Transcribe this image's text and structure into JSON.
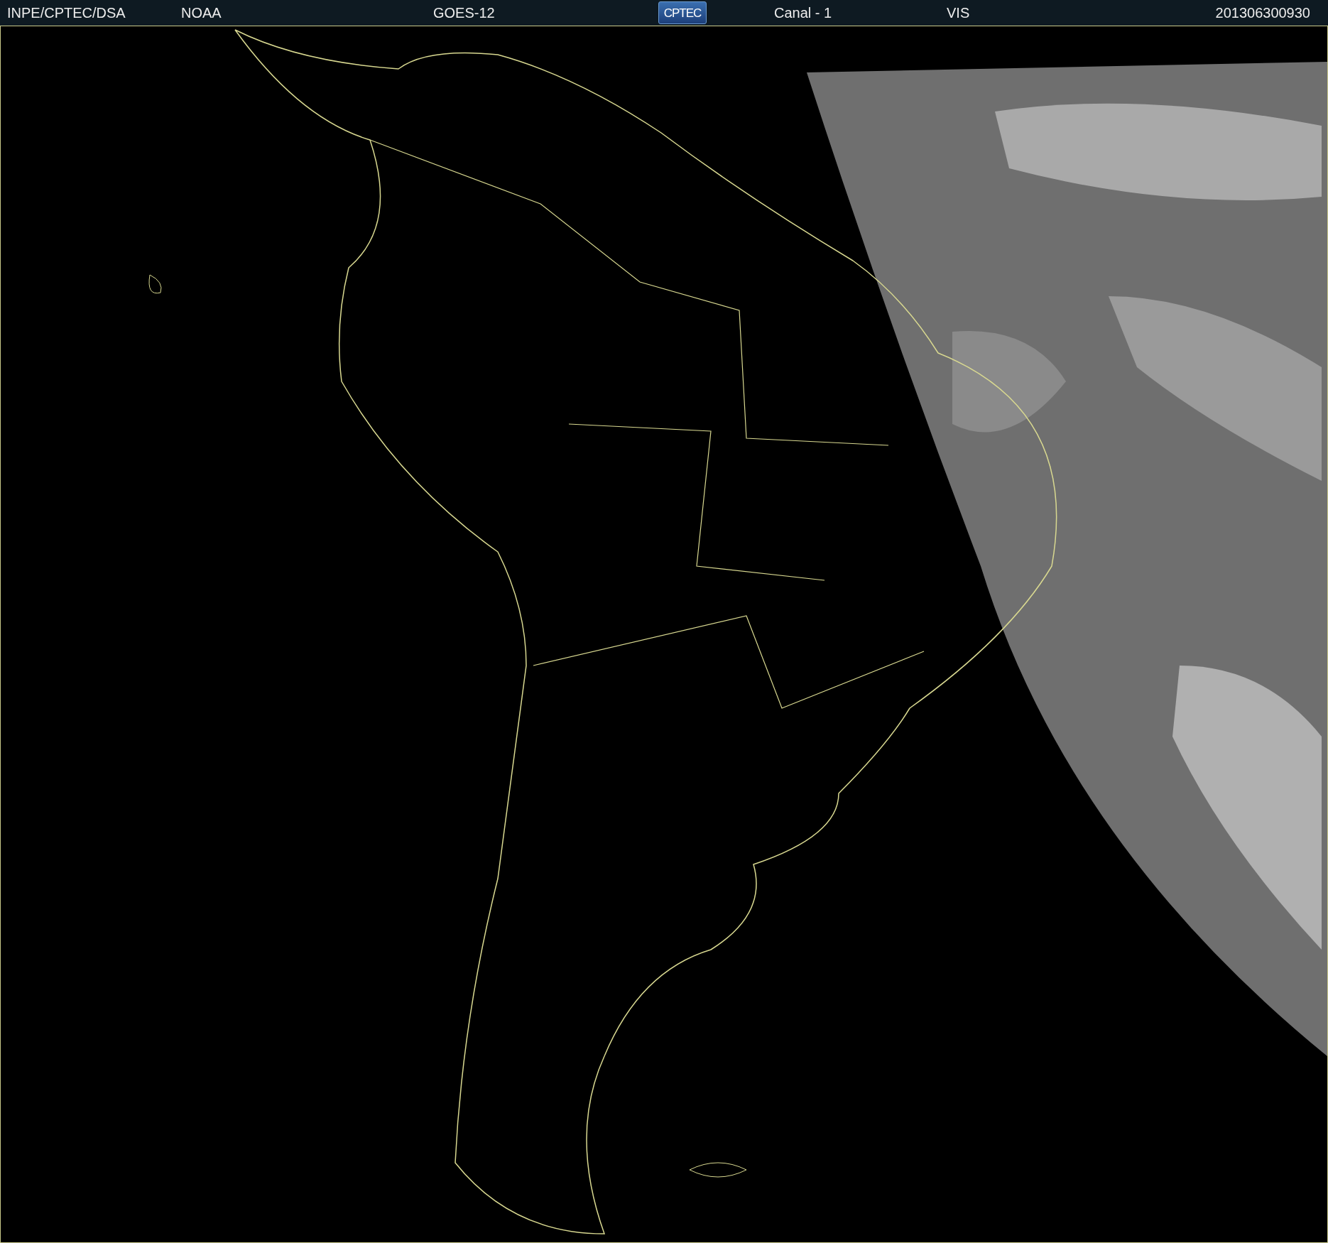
{
  "header": {
    "items": [
      {
        "kind": "text",
        "text": "INPE/CPTEC/DSA"
      },
      {
        "kind": "text",
        "text": "NOAA"
      },
      {
        "kind": "text",
        "text": "GOES-12"
      },
      {
        "kind": "logo",
        "text": "CPTEC"
      },
      {
        "kind": "text",
        "text": "Canal - 1"
      },
      {
        "kind": "text",
        "text": "VIS"
      },
      {
        "kind": "text",
        "text": "201306300930"
      }
    ]
  }
}
